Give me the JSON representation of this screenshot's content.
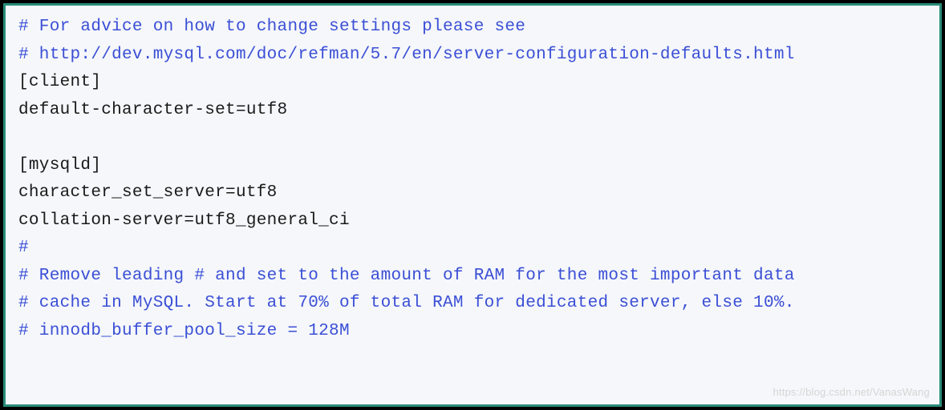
{
  "lines": [
    {
      "type": "comment",
      "text": "# For advice on how to change settings please see"
    },
    {
      "type": "comment",
      "text": "# http://dev.mysql.com/doc/refman/5.7/en/server-configuration-defaults.html"
    },
    {
      "type": "config",
      "text": "[client]"
    },
    {
      "type": "config",
      "text": "default-character-set=utf8"
    },
    {
      "type": "blank",
      "text": ""
    },
    {
      "type": "config",
      "text": "[mysqld]"
    },
    {
      "type": "config",
      "text": "character_set_server=utf8"
    },
    {
      "type": "config",
      "text": "collation-server=utf8_general_ci"
    },
    {
      "type": "comment",
      "text": "#"
    },
    {
      "type": "comment",
      "text": "# Remove leading # and set to the amount of RAM for the most important data"
    },
    {
      "type": "comment",
      "text": "# cache in MySQL. Start at 70% of total RAM for dedicated server, else 10%."
    },
    {
      "type": "comment",
      "text": "# innodb_buffer_pool_size = 128M"
    }
  ],
  "watermark": "https://blog.csdn.net/VanasWang"
}
